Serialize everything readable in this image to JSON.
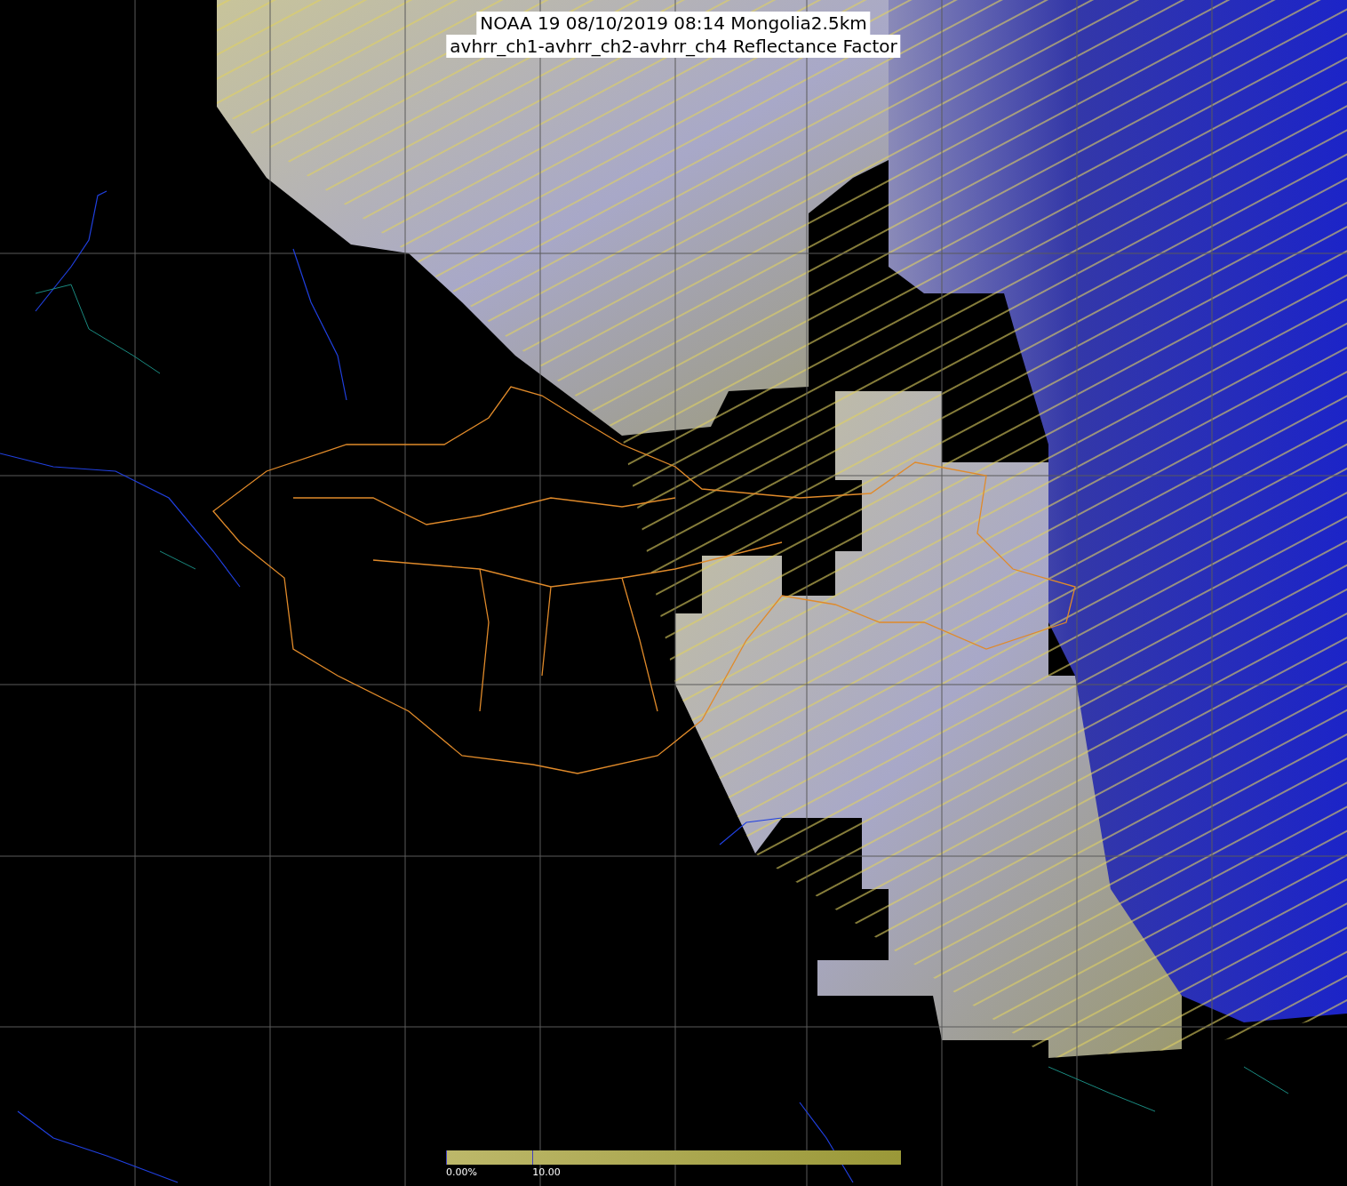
{
  "title": {
    "lines": [
      "NOAA 19 08/10/2019 08:14 Mongolia2.5km",
      "avhrr_ch1-avhrr_ch2-avhrr_ch4 Reflectance Factor"
    ]
  },
  "colorbar": {
    "ticks": [
      "0.00%",
      "10.00"
    ]
  }
}
